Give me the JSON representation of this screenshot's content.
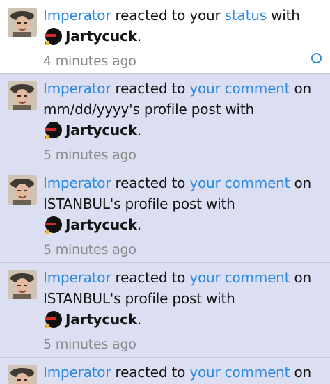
{
  "notifications": [
    {
      "state": "read",
      "actor": "Imperator",
      "text1": "reacted to your",
      "target": "status",
      "text2": "with",
      "reaction": "Jartycuck",
      "period": ".",
      "time": "4 minutes ago",
      "icon": "avatar-man-with-beret"
    },
    {
      "state": "unread",
      "actor": "Imperator",
      "text1": "reacted to",
      "target": "your comment",
      "text2": "on",
      "owner_line": "mm/dd/yyyy's profile post with",
      "reaction": "Jartycuck",
      "period": ".",
      "time": "5 minutes ago",
      "icon": "avatar-man-with-beret"
    },
    {
      "state": "unread",
      "actor": "Imperator",
      "text1": "reacted to",
      "target": "your comment",
      "text2": "on",
      "owner_line": "ISTANBUL's profile post with",
      "reaction": "Jartycuck",
      "period": ".",
      "time": "5 minutes ago",
      "icon": "avatar-man-with-beret"
    },
    {
      "state": "unread",
      "actor": "Imperator",
      "text1": "reacted to",
      "target": "your comment",
      "text2": "on",
      "owner_line": "ISTANBUL's profile post with",
      "reaction": "Jartycuck",
      "period": ".",
      "time": "5 minutes ago",
      "icon": "avatar-man-with-beret"
    },
    {
      "state": "unread",
      "actor": "Imperator",
      "text1": "reacted to",
      "target": "your comment",
      "text2": "on",
      "icon": "avatar-man-with-beret"
    }
  ],
  "colors": {
    "link": "#2b8ae0",
    "unread_bg": "#dcdff2",
    "time": "#8a8a8a"
  },
  "icons": {
    "reaction": "jartycuck-reaction-icon",
    "unread_marker": "mark-read-circle-icon"
  }
}
